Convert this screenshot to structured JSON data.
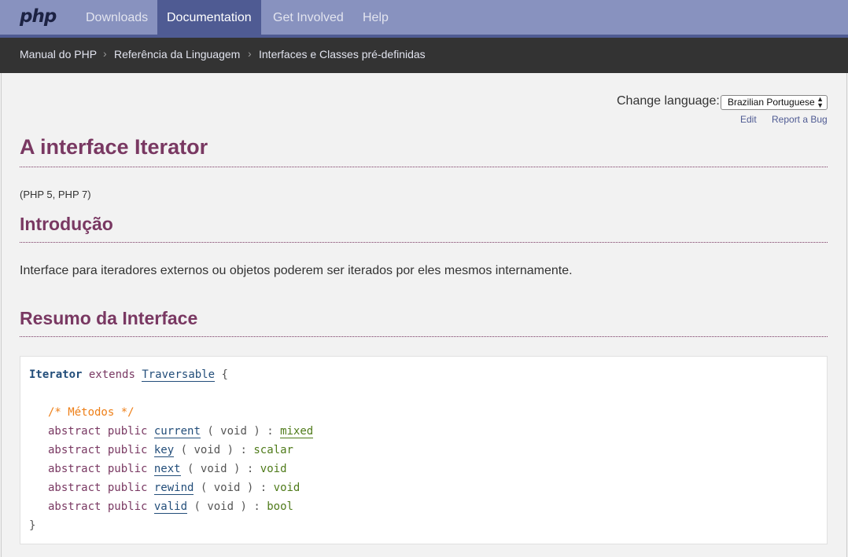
{
  "nav": {
    "logo": "php",
    "items": [
      "Downloads",
      "Documentation",
      "Get Involved",
      "Help"
    ]
  },
  "breadcrumb": [
    "Manual do PHP",
    "Referência da Linguagem",
    "Interfaces e Classes pré-definidas"
  ],
  "breadcrumb_sep": "›",
  "language": {
    "label": "Change language:",
    "selected": "Brazilian Portuguese"
  },
  "links": {
    "edit": "Edit",
    "report": "Report a Bug"
  },
  "title": "A interface Iterator",
  "version": "(PHP 5, PHP 7)",
  "intro": {
    "heading": "Introdução",
    "text": "Interface para iteradores externos ou objetos poderem ser iterados por eles mesmos internamente."
  },
  "summary": {
    "heading": "Resumo da Interface",
    "class_name": "Iterator",
    "extends_kw": "extends",
    "parent": "Traversable",
    "open_brace": "{",
    "close_brace": "}",
    "comment": "/* Métodos */",
    "modifiers": "abstract public",
    "methods": [
      {
        "name": "current",
        "params": "( void )",
        "colon": ":",
        "returns": "mixed"
      },
      {
        "name": "key",
        "params": "( void )",
        "colon": ":",
        "returns": "scalar"
      },
      {
        "name": "next",
        "params": "( void )",
        "colon": ":",
        "returns": "void"
      },
      {
        "name": "rewind",
        "params": "( void )",
        "colon": ":",
        "returns": "void"
      },
      {
        "name": "valid",
        "params": "( void )",
        "colon": ":",
        "returns": "bool"
      }
    ]
  }
}
